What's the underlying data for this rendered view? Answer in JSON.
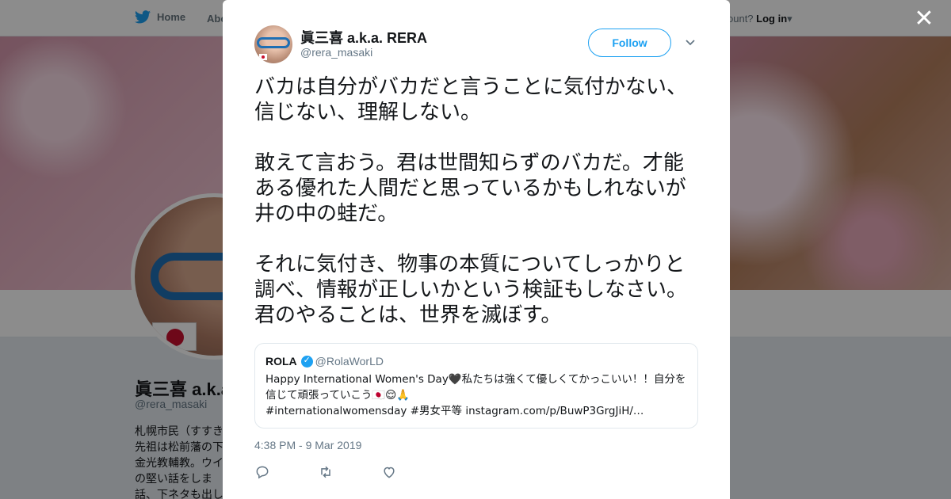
{
  "background": {
    "nav": {
      "home_label": "Home",
      "about_label": "Abo",
      "login_prompt": "ccount?",
      "login_label": "Log in"
    },
    "profile": {
      "name": "眞三喜 a.k.a",
      "handle": "@rera_masaki",
      "bio_lines": [
        "札幌市民（すすき",
        "先祖は松前藩の下",
        "金光教輔教。ウイ",
        "の堅い話をしま",
        "話、下ネタも出し"
      ]
    }
  },
  "modal": {
    "close_icon": "close-icon",
    "author": {
      "name": "眞三喜 a.k.a. RERA",
      "handle": "@rera_masaki"
    },
    "follow_label": "Follow",
    "tweet_paragraphs": [
      "バカは自分がバカだと言うことに気付かない、信じない、理解しない。",
      "敢えて言おう。君は世間知らずのバカだ。才能ある優れた人間だと思っているかもしれないが井の中の蛙だ。",
      "それに気付き、物事の本質についてしっかりと調べ、情報が正しいかという検証もしなさい。君のやることは、世界を滅ぼす。"
    ],
    "quote": {
      "name": "ROLA",
      "handle": "@RolaWorLD",
      "line1": "Happy International Women's Day🖤私たちは強くて優しくてかっこいい！！自分を",
      "line2": "信じて頑張っていこう🇯🇵😌🙏",
      "line3": "#internationalwomensday #男女平等 instagram.com/p/BuwP3GrgJiH/…"
    },
    "timestamp": "4:38 PM - 9 Mar 2019",
    "actions": [
      "reply-icon",
      "retweet-icon",
      "like-icon"
    ]
  },
  "colors": {
    "accent": "#1da1f2",
    "text": "#14171a",
    "secondary": "#657786"
  }
}
